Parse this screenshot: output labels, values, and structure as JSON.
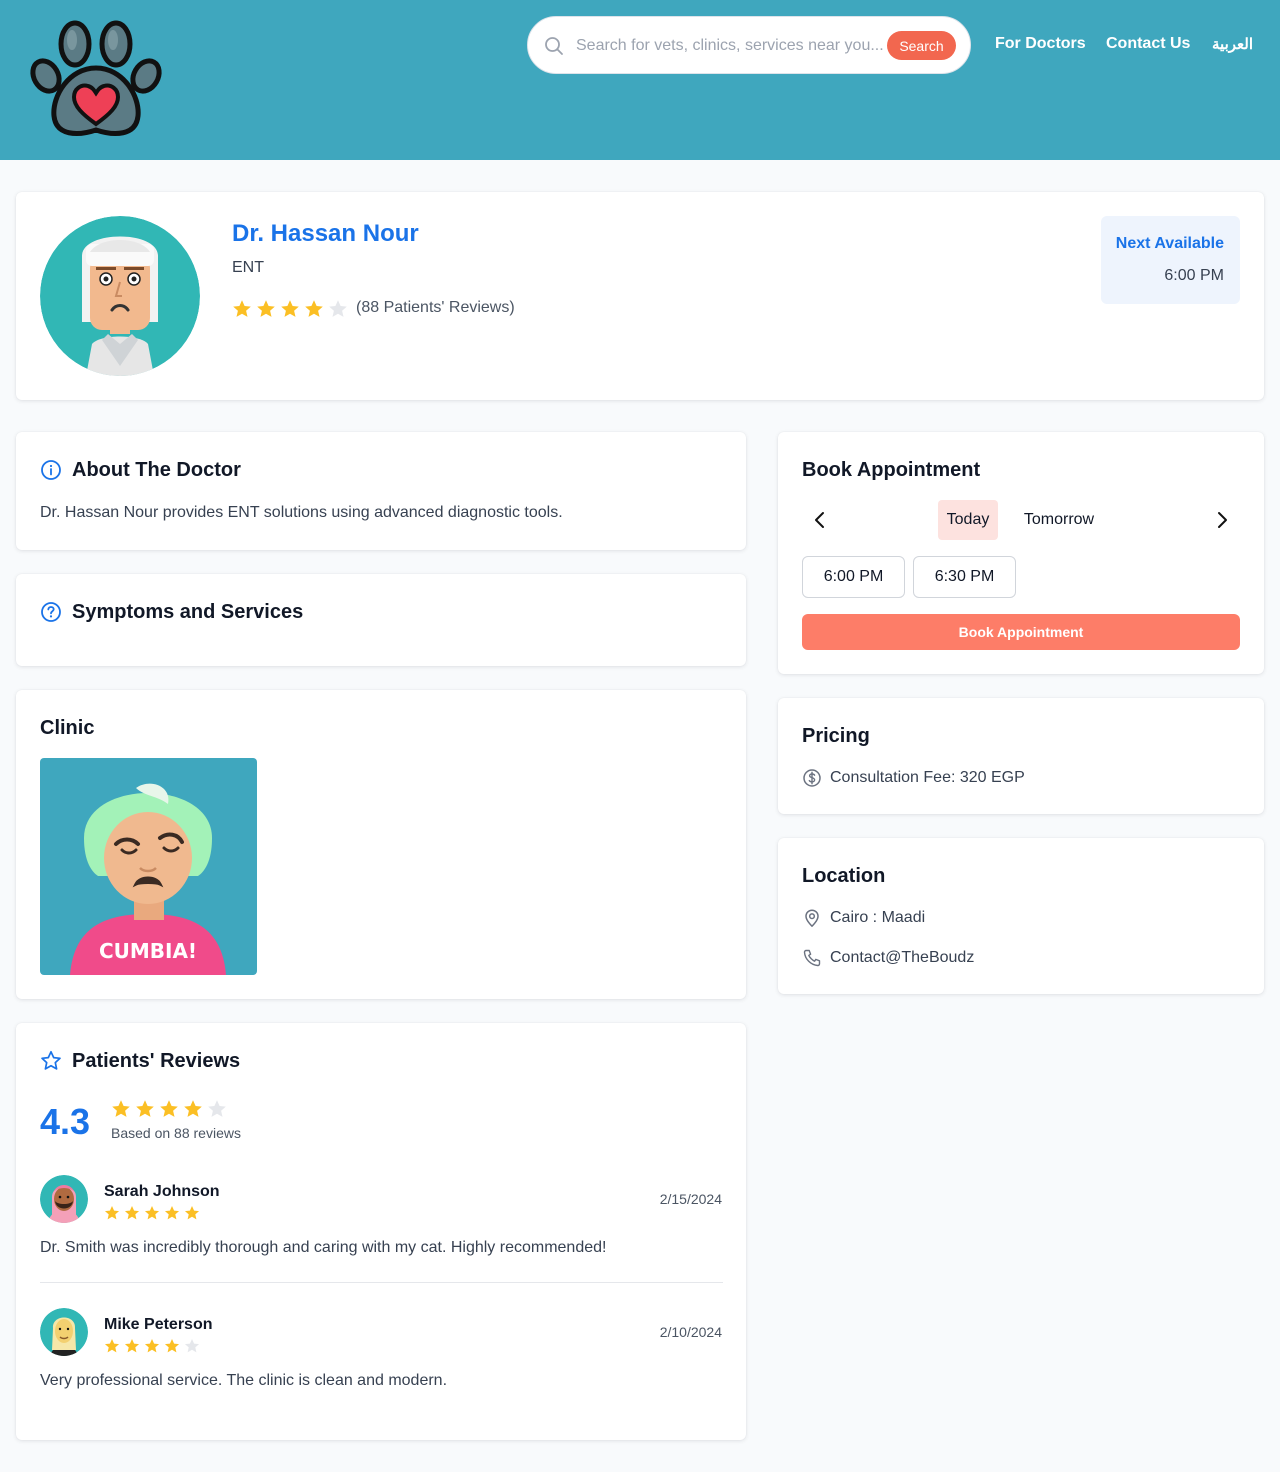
{
  "header": {
    "search": {
      "placeholder": "Search for vets, clinics, services near you...",
      "button_label": "Search"
    },
    "nav": {
      "for_doctors": "For Doctors",
      "contact_us": "Contact Us",
      "language": "العربية"
    }
  },
  "profile": {
    "name": "Dr. Hassan Nour",
    "specialty": "ENT",
    "rating_stars": 4,
    "reviews_count_text": "(88 Patients' Reviews)",
    "next_available_label": "Next Available",
    "next_available_time": "6:00 PM"
  },
  "about": {
    "title": "About The Doctor",
    "text": "Dr. Hassan Nour provides ENT solutions using advanced diagnostic tools."
  },
  "symptoms": {
    "title": "Symptoms and Services"
  },
  "clinic": {
    "title": "Clinic",
    "shirt_text": "CUMBIA!"
  },
  "reviews": {
    "title": "Patients' Reviews",
    "average": "4.3",
    "average_stars": 4,
    "based_on": "Based on 88 reviews",
    "items": [
      {
        "name": "Sarah Johnson",
        "stars": 5,
        "date": "2/15/2024",
        "text": "Dr. Smith was incredibly thorough and caring with my cat. Highly recommended!"
      },
      {
        "name": "Mike Peterson",
        "stars": 4,
        "date": "2/10/2024",
        "text": "Very professional service. The clinic is clean and modern."
      }
    ]
  },
  "booking": {
    "title": "Book Appointment",
    "days": [
      "Today",
      "Tomorrow"
    ],
    "selected_day": "Today",
    "slots": [
      "6:00 PM",
      "6:30 PM"
    ],
    "button_label": "Book Appointment"
  },
  "pricing": {
    "title": "Pricing",
    "fee_text": "Consultation Fee: 320 EGP"
  },
  "location": {
    "title": "Location",
    "address": "Cairo : Maadi",
    "contact": "Contact@TheBoudz"
  },
  "colors": {
    "header_bg": "#3fa7be",
    "primary_blue": "#1a73e8",
    "accent_coral": "#fd7d68",
    "star_filled": "#fbbf24",
    "star_empty": "#e5e7eb"
  }
}
